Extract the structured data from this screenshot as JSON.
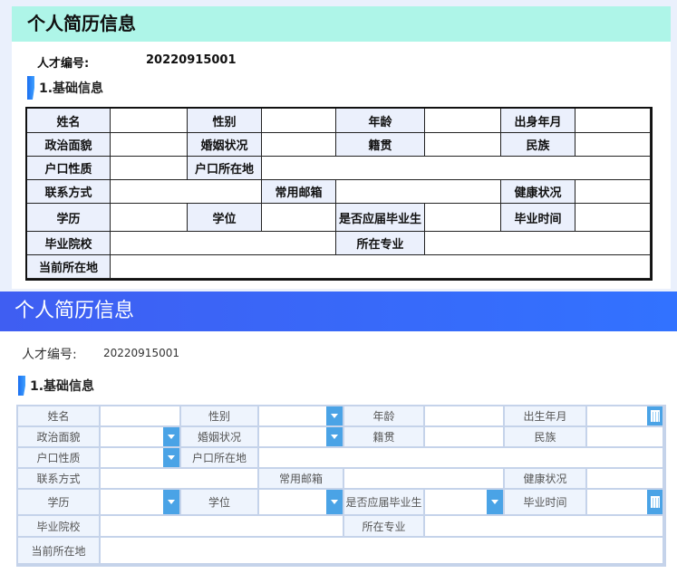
{
  "panel1": {
    "title": "个人简历信息",
    "id_label": "人才编号:",
    "id_value": "20220915001",
    "section": "1.基础信息",
    "labels": {
      "name": "姓名",
      "gender": "性别",
      "age": "年龄",
      "birth": "出身年月",
      "political": "政治面貌",
      "marital": "婚姻状况",
      "native": "籍贯",
      "ethnic": "民族",
      "hukou_type": "户口性质",
      "hukou_loc": "户口所在地",
      "contact": "联系方式",
      "email": "常用邮箱",
      "health": "健康状况",
      "edu": "学历",
      "degree": "学位",
      "fresh": "是否应届毕业生",
      "grad_time": "毕业时间",
      "school": "毕业院校",
      "major": "所在专业",
      "location": "当前所在地"
    }
  },
  "panel2": {
    "title": "个人简历信息",
    "id_label": "人才编号:",
    "id_value": "20220915001",
    "section": "1.基础信息",
    "labels": {
      "name": "姓名",
      "gender": "性别",
      "age": "年龄",
      "birth": "出生年月",
      "political": "政治面貌",
      "marital": "婚姻状况",
      "native": "籍贯",
      "ethnic": "民族",
      "hukou_type": "户口性质",
      "hukou_loc": "户口所在地",
      "contact": "联系方式",
      "email": "常用邮箱",
      "health": "健康状况",
      "edu": "学历",
      "degree": "学位",
      "fresh": "是否应届毕业生",
      "grad_time": "毕业时间",
      "school": "毕业院校",
      "major": "所在专业",
      "location": "当前所在地"
    }
  }
}
